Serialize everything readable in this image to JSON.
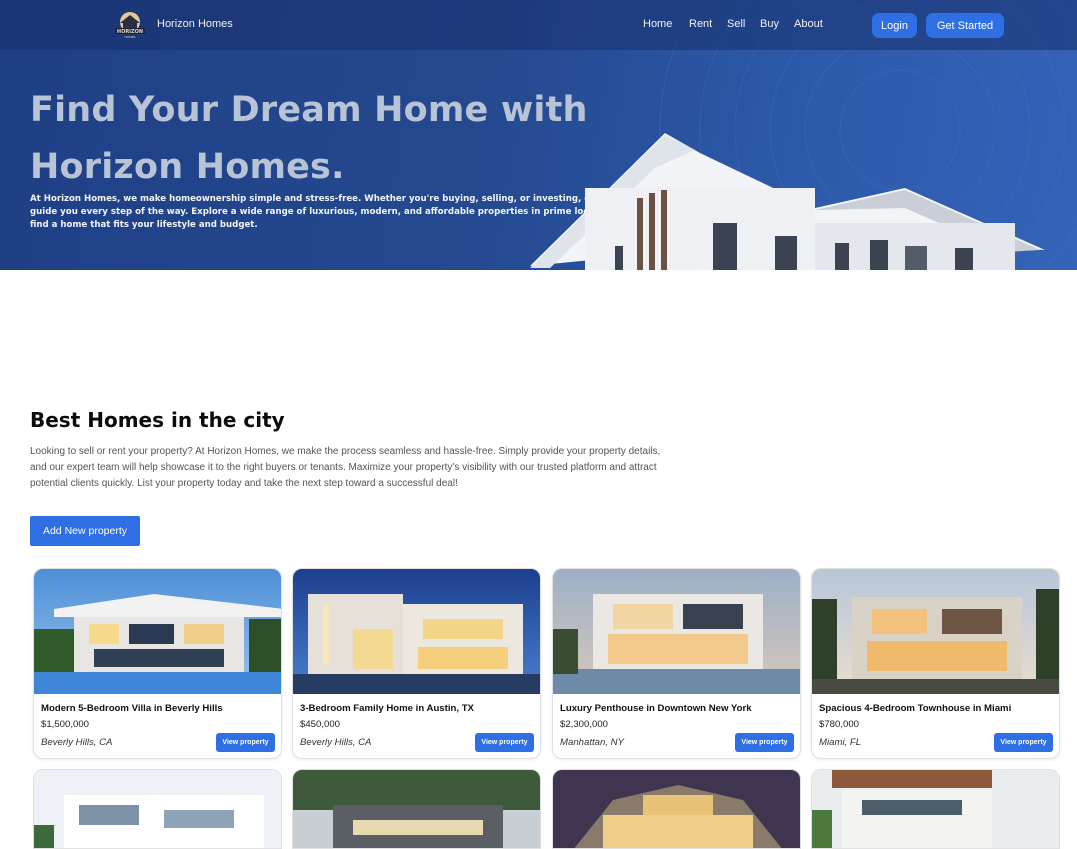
{
  "nav": {
    "brand": "Horizon Homes",
    "logo_text": "HORIZON",
    "logo_sub": "HOMES",
    "links": [
      "Home",
      "Rent",
      "Sell",
      "Buy",
      "About"
    ],
    "login": "Login",
    "get_started": "Get Started"
  },
  "hero": {
    "title": "Find Your Dream Home with Horizon Homes.",
    "description": "At Horizon Homes, we make homeownership simple and stress-free. Whether you're buying, selling, or investing, our expert team is here to guide you every step of the way. Explore a wide range of luxurious, modern, and affordable properties in prime locations. Let us help you find a home that fits your lifestyle and budget."
  },
  "section": {
    "title": "Best Homes in the city",
    "description": "Looking to sell or rent your property? At Horizon Homes, we make the process seamless and hassle-free. Simply provide your property details, and our expert team will help showcase it to the right buyers or tenants. Maximize your property's visibility with our trusted platform and attract potential clients quickly. List your property today and take the next step toward a successful deal!",
    "add_button": "Add New property"
  },
  "listings": [
    {
      "title": "Modern 5-Bedroom Villa in Beverly Hills",
      "price": "$1,500,000",
      "location": "Beverly Hills, CA",
      "button": "View property"
    },
    {
      "title": "3-Bedroom Family Home in Austin, TX",
      "price": "$450,000",
      "location": "Beverly Hills, CA",
      "button": "View property"
    },
    {
      "title": "Luxury Penthouse in Downtown New York",
      "price": "$2,300,000",
      "location": "Manhattan, NY",
      "button": "View property"
    },
    {
      "title": "Spacious 4-Bedroom Townhouse in Miami",
      "price": "$780,000",
      "location": "Miami, FL",
      "button": "View property"
    }
  ],
  "colors": {
    "accent": "#2f6fe4",
    "hero_dark": "#1f3f85",
    "hero_light": "#3563b8"
  }
}
